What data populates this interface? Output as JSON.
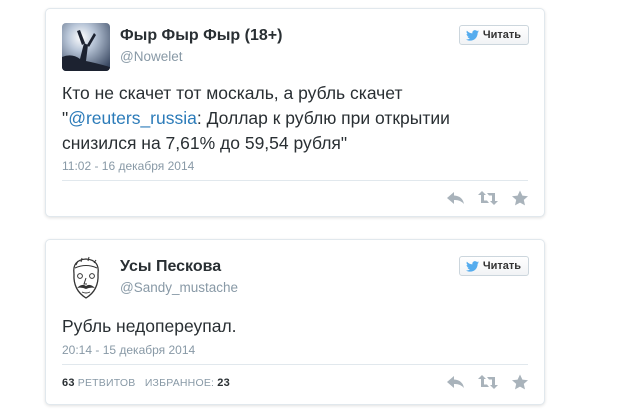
{
  "tweets": [
    {
      "name": "Фыр Фыр Фыр (18+)",
      "handle": "@Nowelet",
      "follow_label": "Читать",
      "text_before": "Кто не скачет тот москаль, а рубль скачет \"",
      "mention": "@reuters_russia",
      "text_after": ": Доллар к рублю при открытии снизился на 7,61% до 59,54 рубля\"",
      "date": "11:02 - 16 декабря 2014"
    },
    {
      "name": "Усы Пескова",
      "handle": "@Sandy_mustache",
      "follow_label": "Читать",
      "text": "Рубль недопереупал.",
      "date": "20:14 - 15 декабря 2014",
      "retweets_count": "63",
      "retweets_label": "РЕТВИТОВ",
      "favorites_label": "ИЗБРАННОЕ:",
      "favorites_count": "23"
    }
  ],
  "icons": {
    "follow": "twitter-bird-icon",
    "reply": "reply-icon",
    "retweet": "retweet-icon",
    "favorite": "star-icon"
  },
  "colors": {
    "link": "#2b7bb9",
    "muted": "#8899a6",
    "icon": "#a9b3bb",
    "bird": "#55acee"
  }
}
